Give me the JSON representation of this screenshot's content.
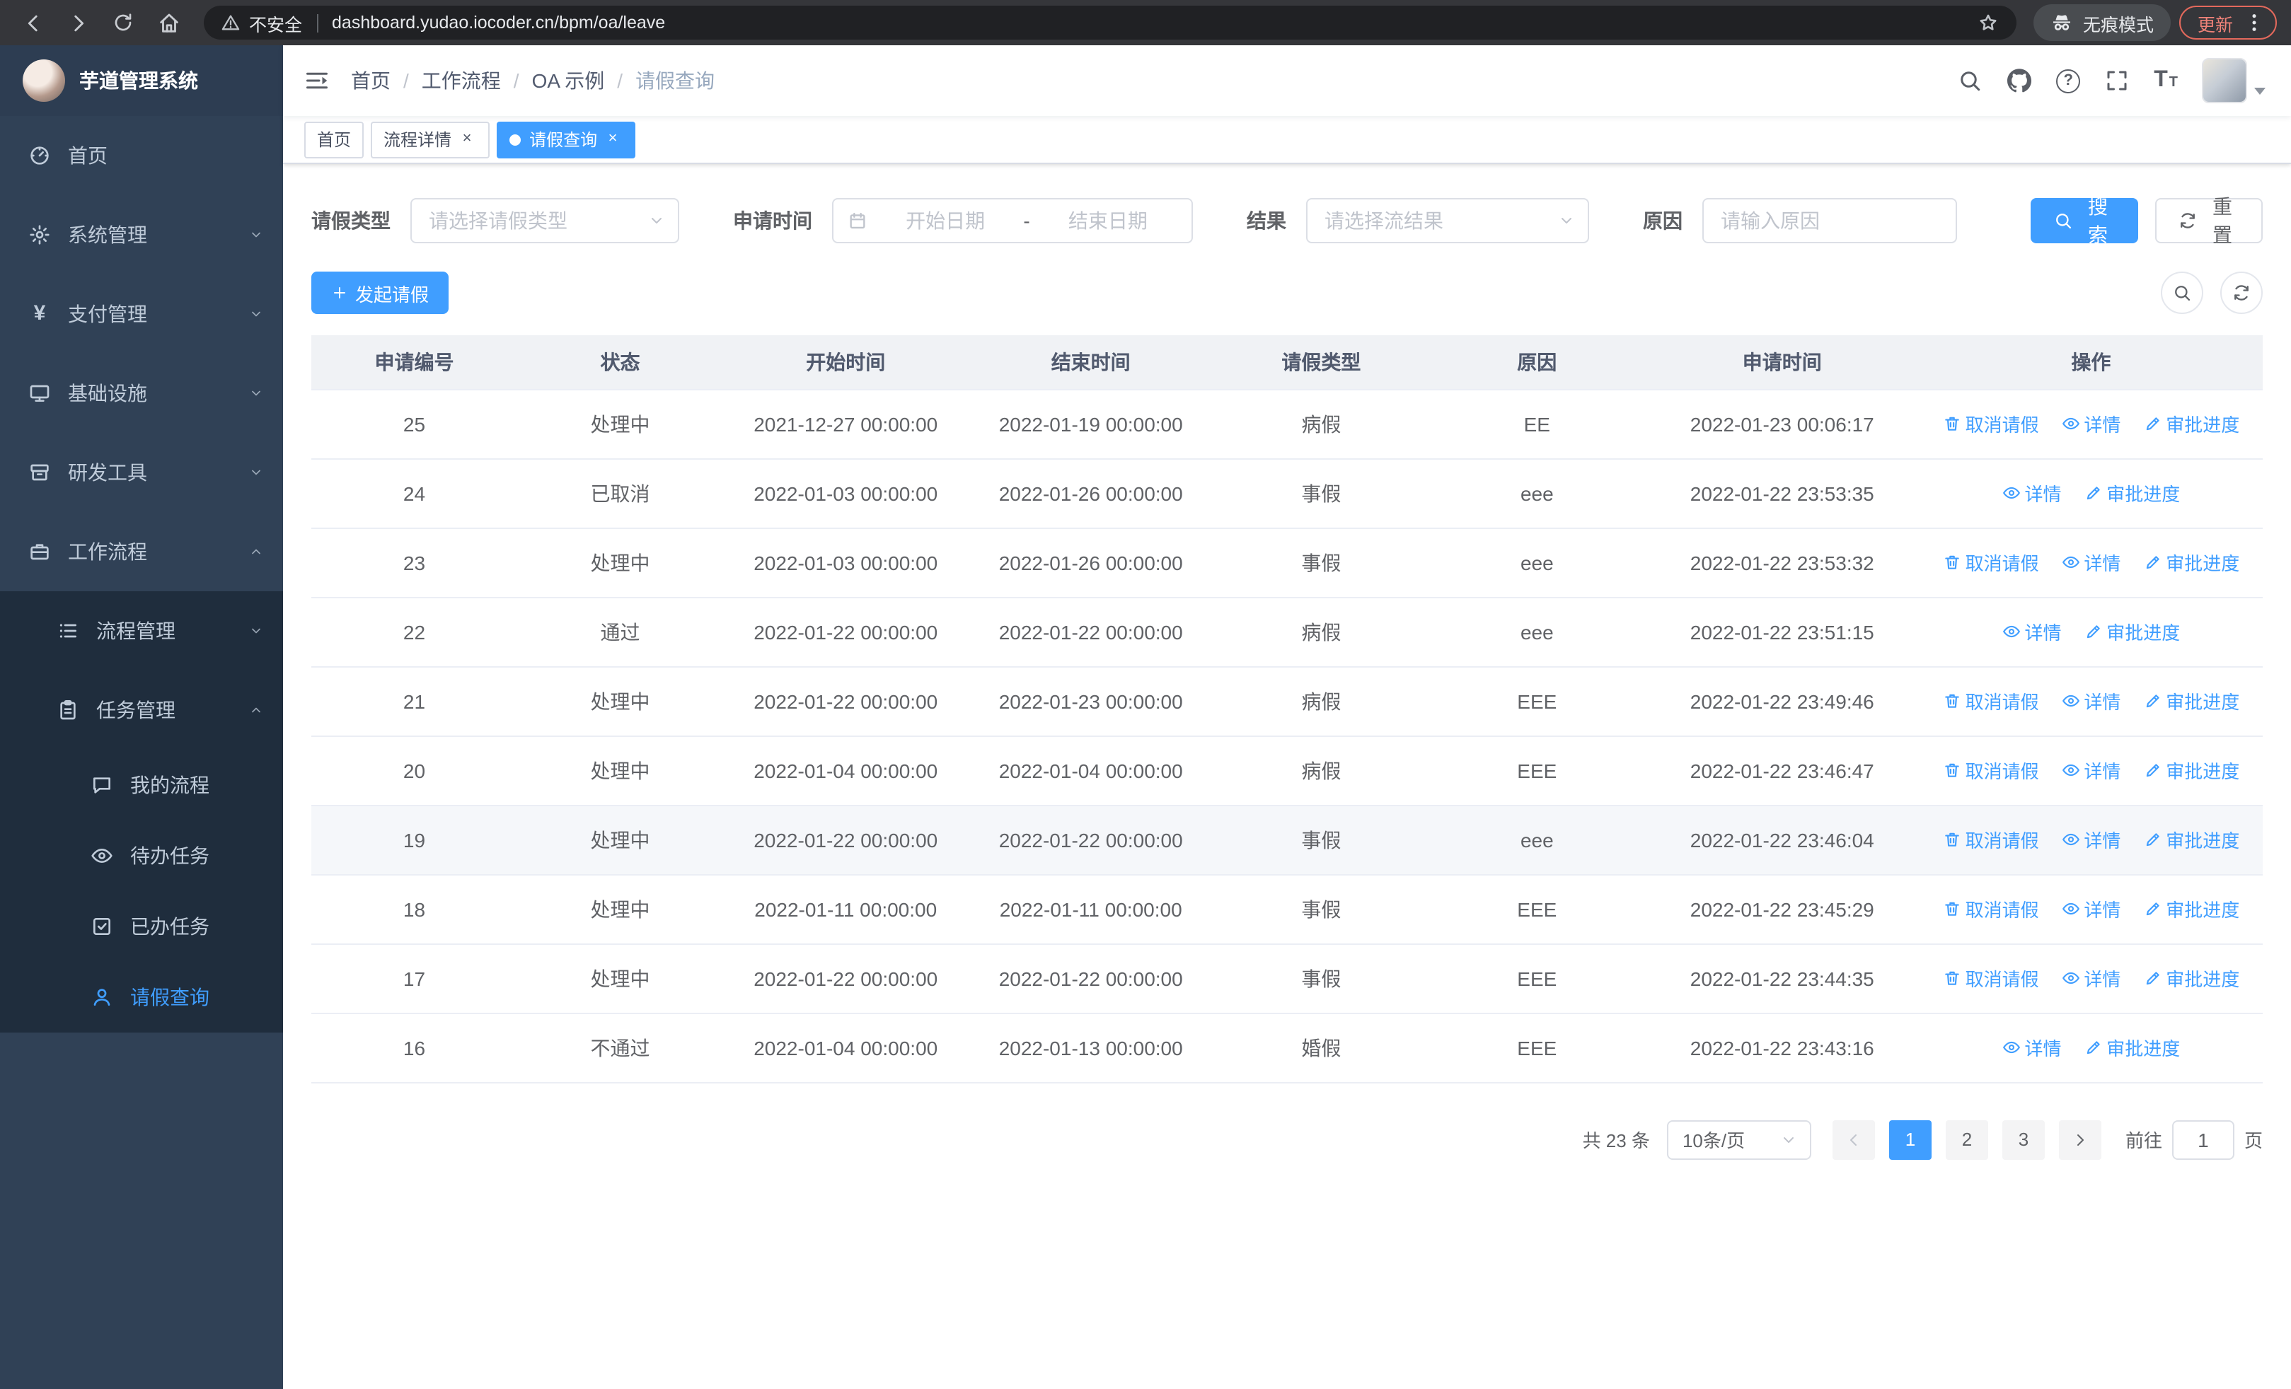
{
  "browser": {
    "security_label": "不安全",
    "url": "dashboard.yudao.iocoder.cn/bpm/oa/leave",
    "incognito_label": "无痕模式",
    "update_label": "更新"
  },
  "sidebar": {
    "logo_title": "芋道管理系统",
    "items": [
      {
        "label": "首页",
        "icon": "dashboard-icon"
      },
      {
        "label": "系统管理",
        "icon": "gear-icon"
      },
      {
        "label": "支付管理",
        "icon": "yen-icon"
      },
      {
        "label": "基础设施",
        "icon": "monitor-icon"
      },
      {
        "label": "研发工具",
        "icon": "toolbox-icon"
      },
      {
        "label": "工作流程",
        "icon": "briefcase-icon"
      },
      {
        "label": "流程管理",
        "icon": "list-icon"
      },
      {
        "label": "任务管理",
        "icon": "clipboard-icon"
      },
      {
        "label": "我的流程",
        "icon": "chat-icon"
      },
      {
        "label": "待办任务",
        "icon": "eye-icon"
      },
      {
        "label": "已办任务",
        "icon": "check-square-icon"
      },
      {
        "label": "请假查询",
        "icon": "user-icon"
      }
    ]
  },
  "navbar": {
    "breadcrumb": [
      "首页",
      "工作流程",
      "OA 示例",
      "请假查询"
    ]
  },
  "tabs": [
    {
      "label": "首页"
    },
    {
      "label": "流程详情"
    },
    {
      "label": "请假查询"
    }
  ],
  "filters": {
    "type_label": "请假类型",
    "type_placeholder": "请选择请假类型",
    "time_label": "申请时间",
    "time_start_placeholder": "开始日期",
    "time_separator": "-",
    "time_end_placeholder": "结束日期",
    "result_label": "结果",
    "result_placeholder": "请选择流结果",
    "reason_label": "原因",
    "reason_placeholder": "请输入原因",
    "search_label": "搜索",
    "reset_label": "重置"
  },
  "toolbar": {
    "create_label": "发起请假"
  },
  "table": {
    "headers": [
      "申请编号",
      "状态",
      "开始时间",
      "结束时间",
      "请假类型",
      "原因",
      "申请时间",
      "操作"
    ],
    "rows": [
      {
        "id": "25",
        "status": "处理中",
        "start": "2021-12-27 00:00:00",
        "end": "2022-01-19 00:00:00",
        "type": "病假",
        "reason": "EE",
        "applyTime": "2022-01-23 00:06:17",
        "cancel": "取消请假",
        "detail": "详情",
        "progress": "审批进度"
      },
      {
        "id": "24",
        "status": "已取消",
        "start": "2022-01-03 00:00:00",
        "end": "2022-01-26 00:00:00",
        "type": "事假",
        "reason": "eee",
        "applyTime": "2022-01-22 23:53:35",
        "detail": "详情",
        "progress": "审批进度"
      },
      {
        "id": "23",
        "status": "处理中",
        "start": "2022-01-03 00:00:00",
        "end": "2022-01-26 00:00:00",
        "type": "事假",
        "reason": "eee",
        "applyTime": "2022-01-22 23:53:32",
        "cancel": "取消请假",
        "detail": "详情",
        "progress": "审批进度"
      },
      {
        "id": "22",
        "status": "通过",
        "start": "2022-01-22 00:00:00",
        "end": "2022-01-22 00:00:00",
        "type": "病假",
        "reason": "eee",
        "applyTime": "2022-01-22 23:51:15",
        "detail": "详情",
        "progress": "审批进度"
      },
      {
        "id": "21",
        "status": "处理中",
        "start": "2022-01-22 00:00:00",
        "end": "2022-01-23 00:00:00",
        "type": "病假",
        "reason": "EEE",
        "applyTime": "2022-01-22 23:49:46",
        "cancel": "取消请假",
        "detail": "详情",
        "progress": "审批进度"
      },
      {
        "id": "20",
        "status": "处理中",
        "start": "2022-01-04 00:00:00",
        "end": "2022-01-04 00:00:00",
        "type": "病假",
        "reason": "EEE",
        "applyTime": "2022-01-22 23:46:47",
        "cancel": "取消请假",
        "detail": "详情",
        "progress": "审批进度"
      },
      {
        "id": "19",
        "status": "处理中",
        "start": "2022-01-22 00:00:00",
        "end": "2022-01-22 00:00:00",
        "type": "事假",
        "reason": "eee",
        "applyTime": "2022-01-22 23:46:04",
        "cancel": "取消请假",
        "detail": "详情",
        "progress": "审批进度"
      },
      {
        "id": "18",
        "status": "处理中",
        "start": "2022-01-11 00:00:00",
        "end": "2022-01-11 00:00:00",
        "type": "事假",
        "reason": "EEE",
        "applyTime": "2022-01-22 23:45:29",
        "cancel": "取消请假",
        "detail": "详情",
        "progress": "审批进度"
      },
      {
        "id": "17",
        "status": "处理中",
        "start": "2022-01-22 00:00:00",
        "end": "2022-01-22 00:00:00",
        "type": "事假",
        "reason": "EEE",
        "applyTime": "2022-01-22 23:44:35",
        "cancel": "取消请假",
        "detail": "详情",
        "progress": "审批进度"
      },
      {
        "id": "16",
        "status": "不通过",
        "start": "2022-01-04 00:00:00",
        "end": "2022-01-13 00:00:00",
        "type": "婚假",
        "reason": "EEE",
        "applyTime": "2022-01-22 23:43:16",
        "detail": "详情",
        "progress": "审批进度"
      }
    ]
  },
  "pagination": {
    "total_label": "共 23 条",
    "page_size_label": "10条/页",
    "pages": [
      "1",
      "2",
      "3"
    ],
    "goto_label": "前往",
    "goto_value": "1",
    "goto_suffix": "页"
  }
}
